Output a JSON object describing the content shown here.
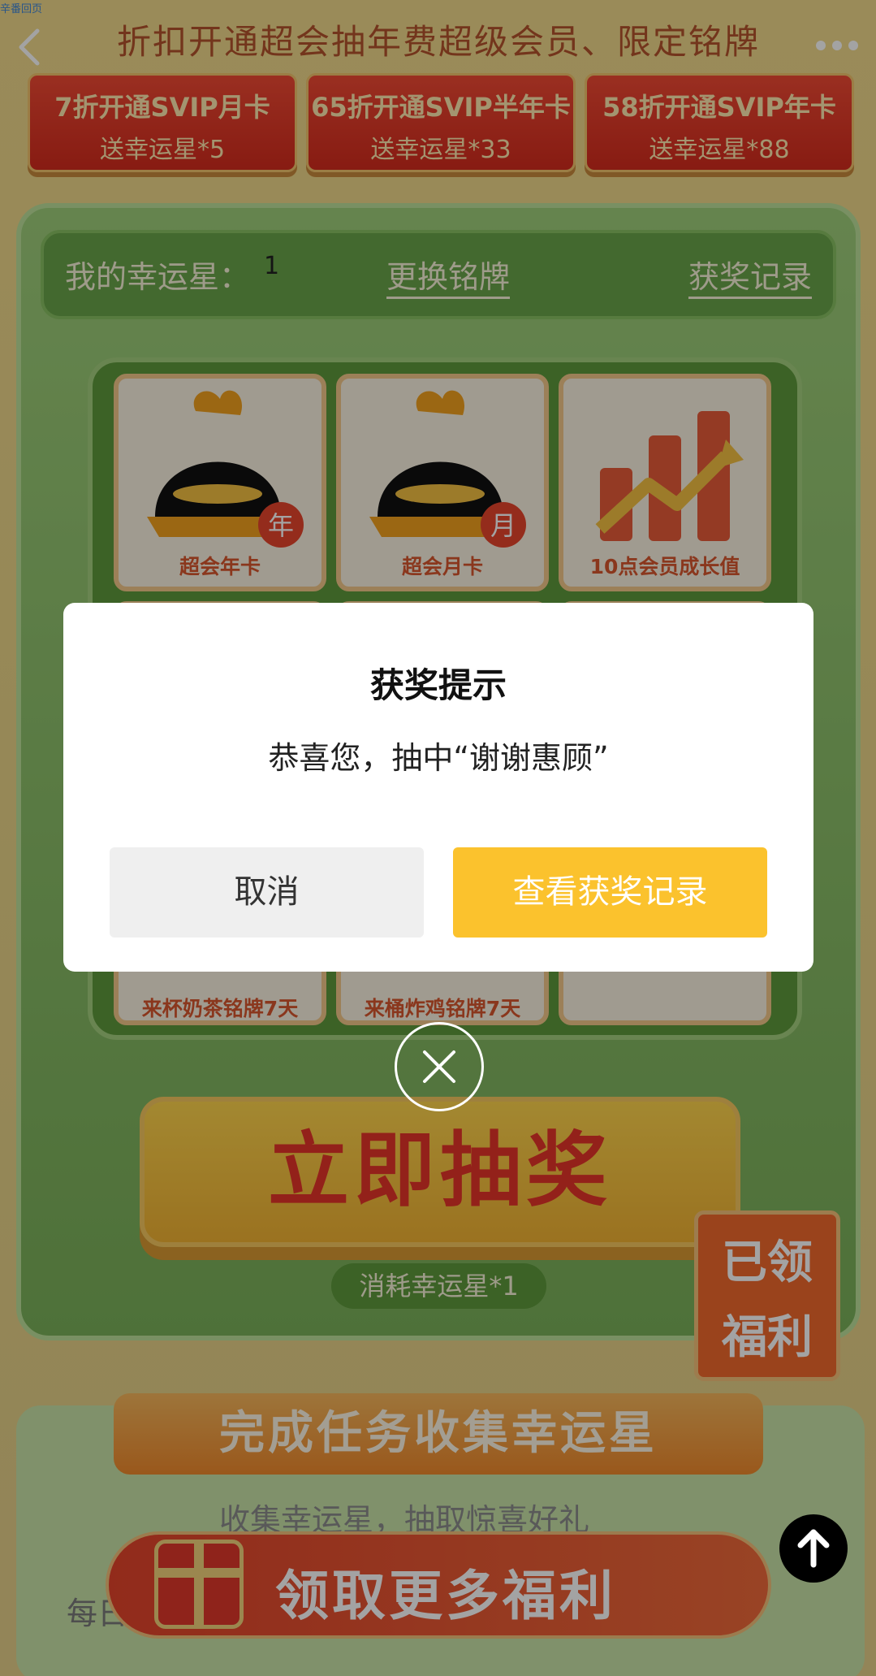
{
  "header": {
    "corner_link": "辛番回页",
    "title": "折扣开通超会抽年费超级会员、限定铭牌",
    "back_icon": "chevron-left-icon",
    "more_icon": "more-dots-icon"
  },
  "offers": [
    {
      "line1": "7折开通SVIP月卡",
      "line2": "送幸运星*5"
    },
    {
      "line1": "65折开通SVIP半年卡",
      "line2": "送幸运星*33"
    },
    {
      "line1": "58折开通SVIP年卡",
      "line2": "送幸运星*88"
    }
  ],
  "lottery": {
    "stars_label": "我的幸运星：",
    "stars_count": "1",
    "change_badge": "更换铭牌",
    "prize_records": "获奖记录",
    "prizes": [
      {
        "label": "超会年卡",
        "badge": "年"
      },
      {
        "label": "超会月卡",
        "badge": "月"
      },
      {
        "label": "10点会员成长值"
      },
      {
        "label": "来杯奶茶铭牌7天"
      },
      {
        "label": "来桶炸鸡铭牌7天"
      }
    ],
    "draw_button": "立即抽奖",
    "consume_text": "消耗幸运星*1",
    "welfare_stamp": [
      "已领",
      "福利"
    ]
  },
  "tasks": {
    "banner": "完成任务收集幸运星",
    "subtitle": "收集幸运星，抽取惊喜好礼",
    "more_welfare": "领取更多福利",
    "row_text_partial": "每日"
  },
  "modal": {
    "title": "获奖提示",
    "message": "恭喜您，抽中“谢谢惠顾”",
    "cancel": "取消",
    "view_records": "查看获奖记录"
  },
  "colors": {
    "accent": "#fbc22d",
    "brand_red": "#e6352a",
    "machine_green": "#7bb15a"
  }
}
